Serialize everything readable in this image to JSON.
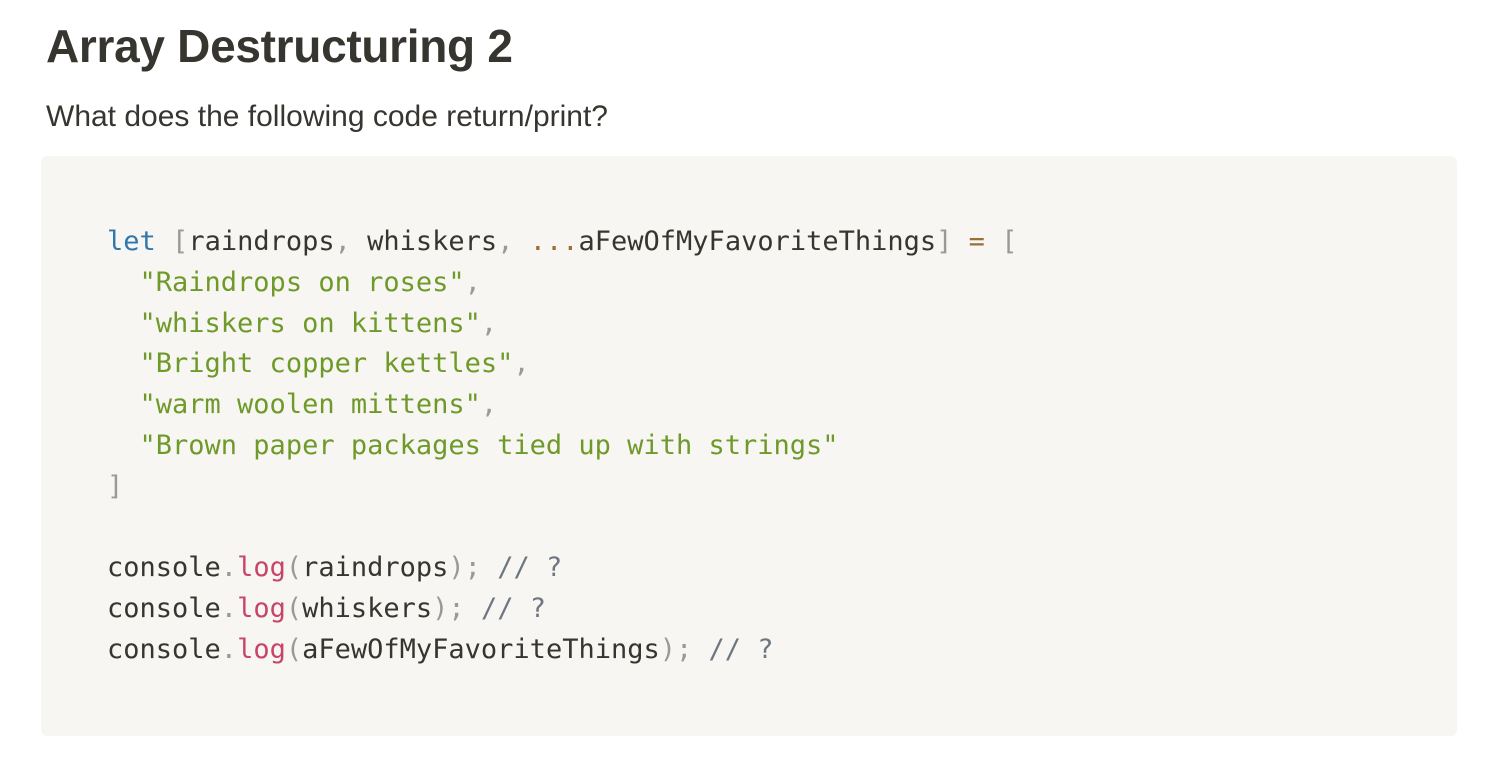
{
  "page": {
    "title": "Array Destructuring 2",
    "prompt": "What does the following code return/print?"
  },
  "code": {
    "lines": [
      [
        {
          "t": "kw",
          "v": "let"
        },
        {
          "t": "plain",
          "v": " "
        },
        {
          "t": "punc",
          "v": "["
        },
        {
          "t": "plain",
          "v": "raindrops"
        },
        {
          "t": "punc",
          "v": ","
        },
        {
          "t": "plain",
          "v": " whiskers"
        },
        {
          "t": "punc",
          "v": ","
        },
        {
          "t": "plain",
          "v": " "
        },
        {
          "t": "op",
          "v": "..."
        },
        {
          "t": "plain",
          "v": "aFewOfMyFavoriteThings"
        },
        {
          "t": "punc",
          "v": "]"
        },
        {
          "t": "plain",
          "v": " "
        },
        {
          "t": "op",
          "v": "="
        },
        {
          "t": "plain",
          "v": " "
        },
        {
          "t": "punc",
          "v": "["
        }
      ],
      [
        {
          "t": "plain",
          "v": "  "
        },
        {
          "t": "str",
          "v": "\"Raindrops on roses\""
        },
        {
          "t": "punc",
          "v": ","
        }
      ],
      [
        {
          "t": "plain",
          "v": "  "
        },
        {
          "t": "str",
          "v": "\"whiskers on kittens\""
        },
        {
          "t": "punc",
          "v": ","
        }
      ],
      [
        {
          "t": "plain",
          "v": "  "
        },
        {
          "t": "str",
          "v": "\"Bright copper kettles\""
        },
        {
          "t": "punc",
          "v": ","
        }
      ],
      [
        {
          "t": "plain",
          "v": "  "
        },
        {
          "t": "str",
          "v": "\"warm woolen mittens\""
        },
        {
          "t": "punc",
          "v": ","
        }
      ],
      [
        {
          "t": "plain",
          "v": "  "
        },
        {
          "t": "str",
          "v": "\"Brown paper packages tied up with strings\""
        }
      ],
      [
        {
          "t": "punc",
          "v": "]"
        }
      ],
      [],
      [
        {
          "t": "plain",
          "v": "console"
        },
        {
          "t": "punc",
          "v": "."
        },
        {
          "t": "fn",
          "v": "log"
        },
        {
          "t": "punc",
          "v": "("
        },
        {
          "t": "plain",
          "v": "raindrops"
        },
        {
          "t": "punc",
          "v": ");"
        },
        {
          "t": "plain",
          "v": " "
        },
        {
          "t": "cm",
          "v": "// ?"
        }
      ],
      [
        {
          "t": "plain",
          "v": "console"
        },
        {
          "t": "punc",
          "v": "."
        },
        {
          "t": "fn",
          "v": "log"
        },
        {
          "t": "punc",
          "v": "("
        },
        {
          "t": "plain",
          "v": "whiskers"
        },
        {
          "t": "punc",
          "v": ");"
        },
        {
          "t": "plain",
          "v": " "
        },
        {
          "t": "cm",
          "v": "// ?"
        }
      ],
      [
        {
          "t": "plain",
          "v": "console"
        },
        {
          "t": "punc",
          "v": "."
        },
        {
          "t": "fn",
          "v": "log"
        },
        {
          "t": "punc",
          "v": "("
        },
        {
          "t": "plain",
          "v": "aFewOfMyFavoriteThings"
        },
        {
          "t": "punc",
          "v": ");"
        },
        {
          "t": "plain",
          "v": " "
        },
        {
          "t": "cm",
          "v": "// ?"
        }
      ]
    ]
  },
  "colors": {
    "keyword": "#2f77ad",
    "string": "#6f9a2a",
    "punctuation": "#999999",
    "operator": "#9a6e3a",
    "function": "#c7456a",
    "comment": "#6e7781",
    "code_background": "#f7f6f3",
    "text": "#37352f"
  }
}
